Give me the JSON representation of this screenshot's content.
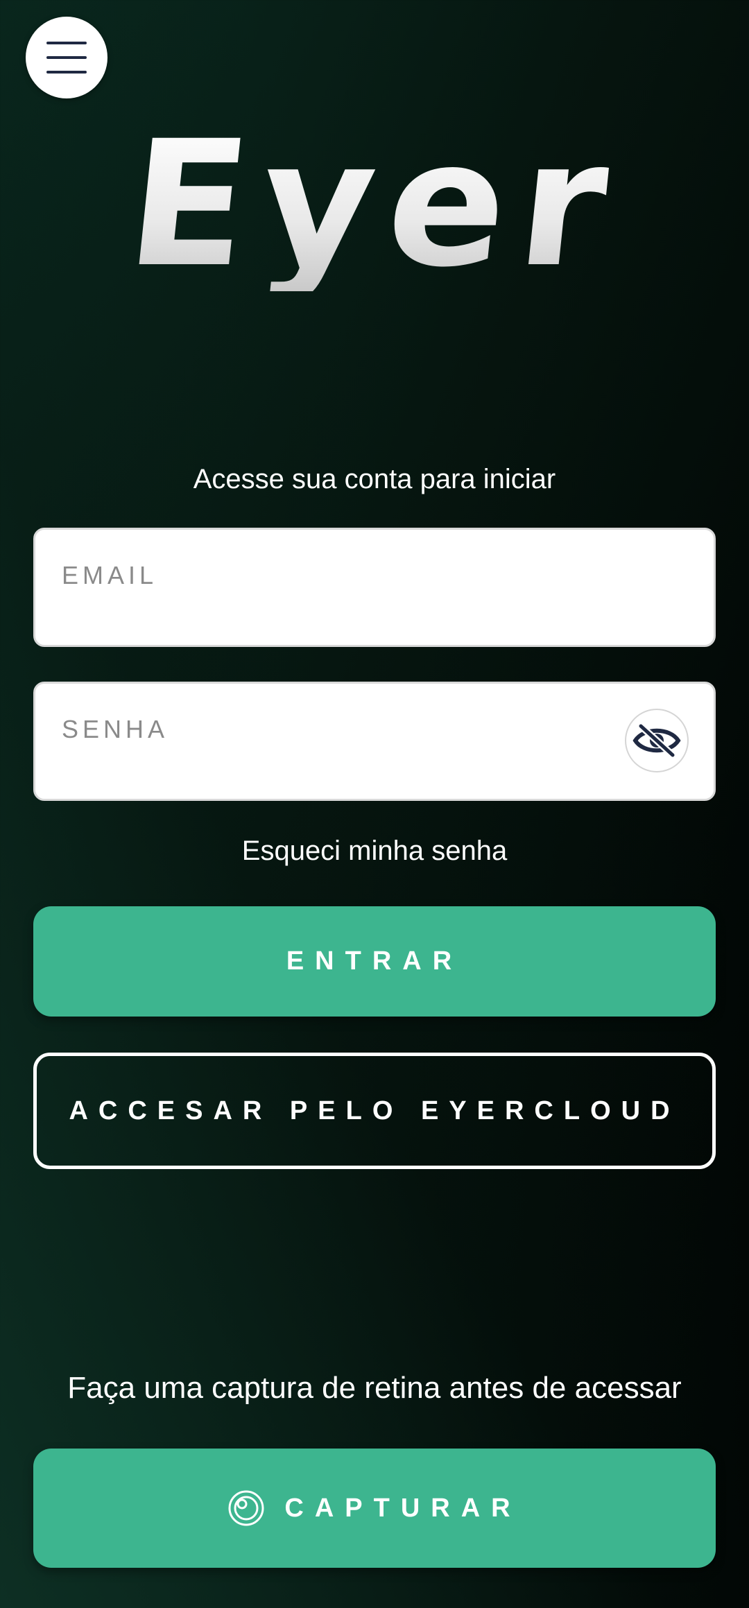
{
  "app": {
    "logo_text": "Eyer"
  },
  "login": {
    "subtitle": "Acesse sua conta para iniciar",
    "email_placeholder": "EMAIL",
    "email_value": "",
    "password_placeholder": "SENHA",
    "password_value": "",
    "forgot_password": "Esqueci minha senha",
    "login_button": "ENTRAR",
    "eyercloud_button": "ACCESAR PELO EYERCLOUD"
  },
  "capture": {
    "hint": "Faça uma captura de retina antes de acessar",
    "button": "CAPTURAR"
  },
  "icons": {
    "menu": "hamburger-menu-icon",
    "password_toggle": "eye-slash-icon",
    "capture": "retina-capture-icon"
  },
  "colors": {
    "accent": "#3db58f",
    "icon_dark": "#1f2942"
  }
}
